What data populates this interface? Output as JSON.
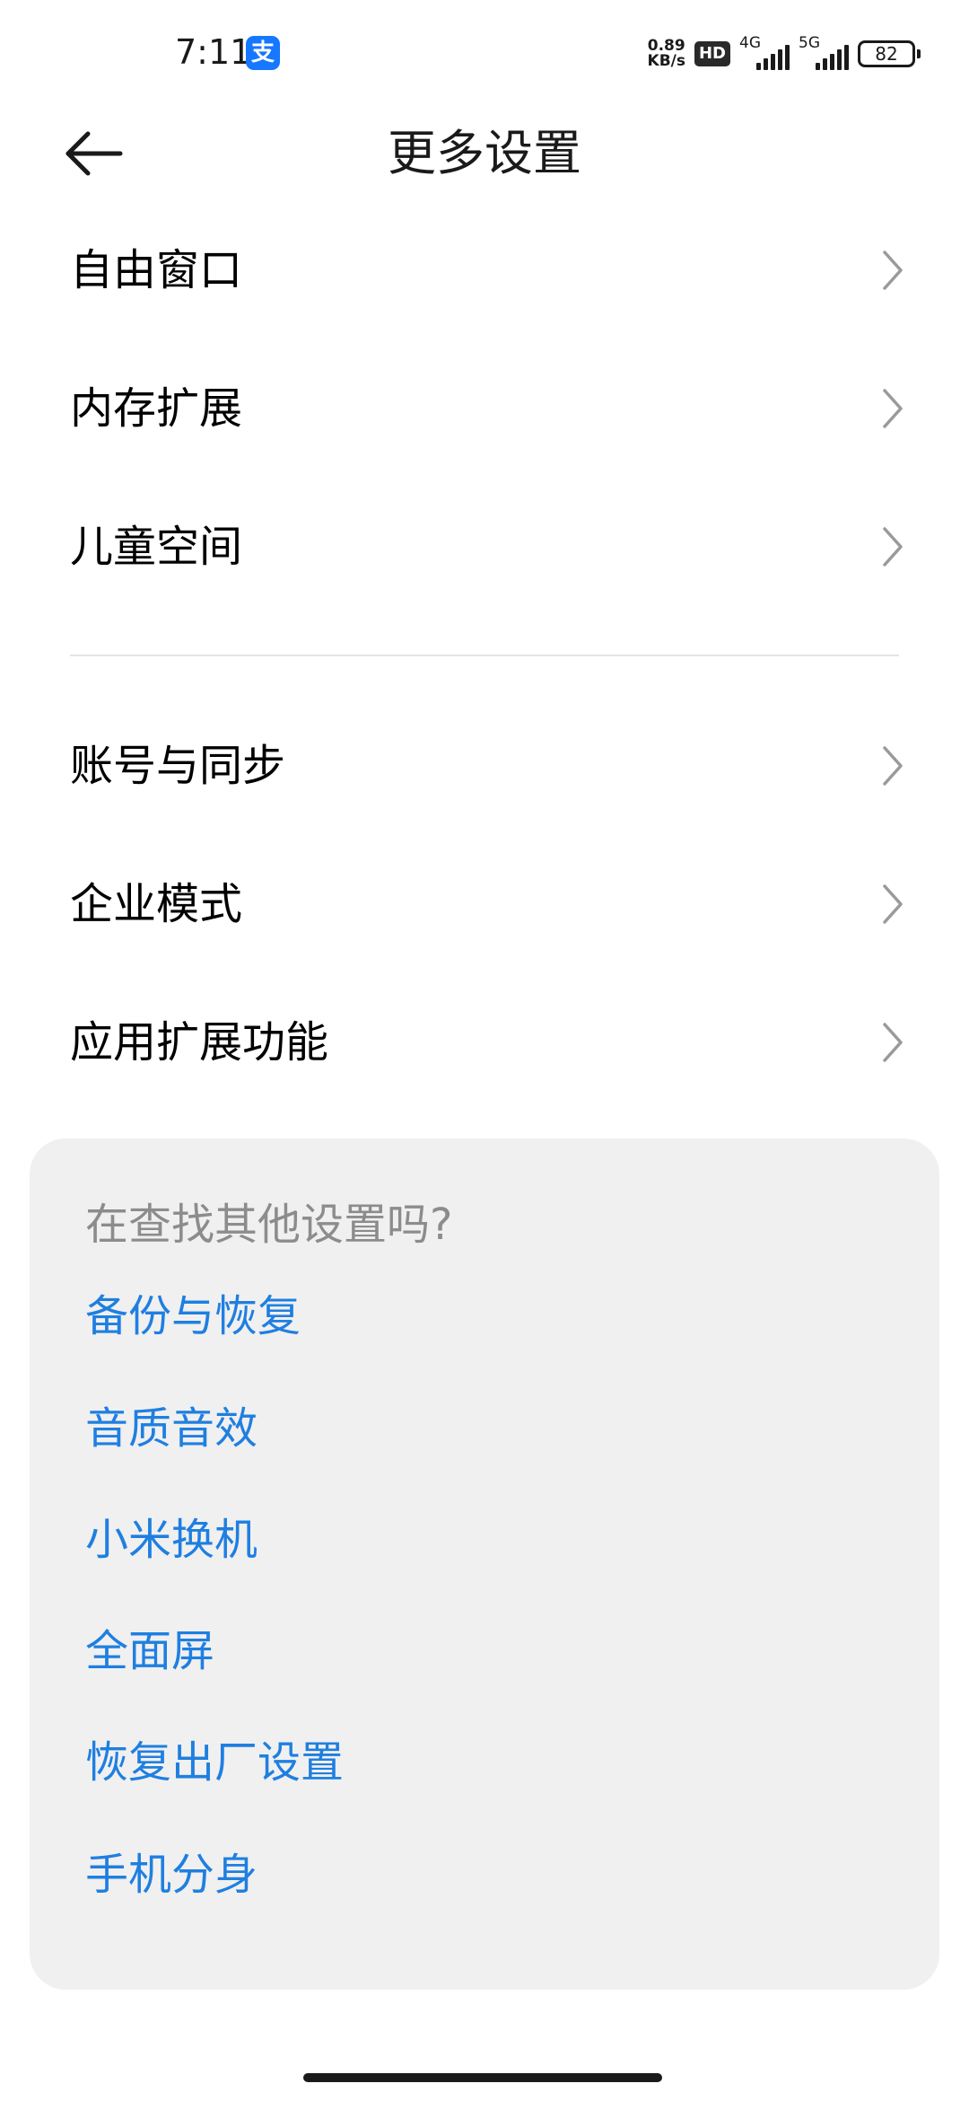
{
  "status_bar": {
    "time": "7:11",
    "alipay_glyph": "支",
    "net_speed_value": "0.89",
    "net_speed_unit": "KB/s",
    "hd_label": "HD",
    "sim1_label": "4G",
    "sim2_label": "5G",
    "battery": "82",
    "icons": [
      "alipay-icon",
      "hd-voice-icon",
      "signal-icon",
      "battery-icon"
    ]
  },
  "header": {
    "title": "更多设置",
    "back_icon": "back-arrow-icon"
  },
  "section1": [
    {
      "label": "自由窗口"
    },
    {
      "label": "内存扩展"
    },
    {
      "label": "儿童空间"
    }
  ],
  "section2": [
    {
      "label": "账号与同步"
    },
    {
      "label": "企业模式"
    },
    {
      "label": "应用扩展功能"
    }
  ],
  "suggestions": {
    "heading": "在查找其他设置吗?",
    "links": [
      {
        "label": "备份与恢复"
      },
      {
        "label": "音质音效"
      },
      {
        "label": "小米换机"
      },
      {
        "label": "全面屏"
      },
      {
        "label": "恢复出厂设置"
      },
      {
        "label": "手机分身"
      }
    ]
  },
  "colors": {
    "link": "#1f7fe0",
    "card_bg": "#f0f0f0",
    "muted_text": "#8c8c8c",
    "chevron": "#9a9a9a"
  }
}
